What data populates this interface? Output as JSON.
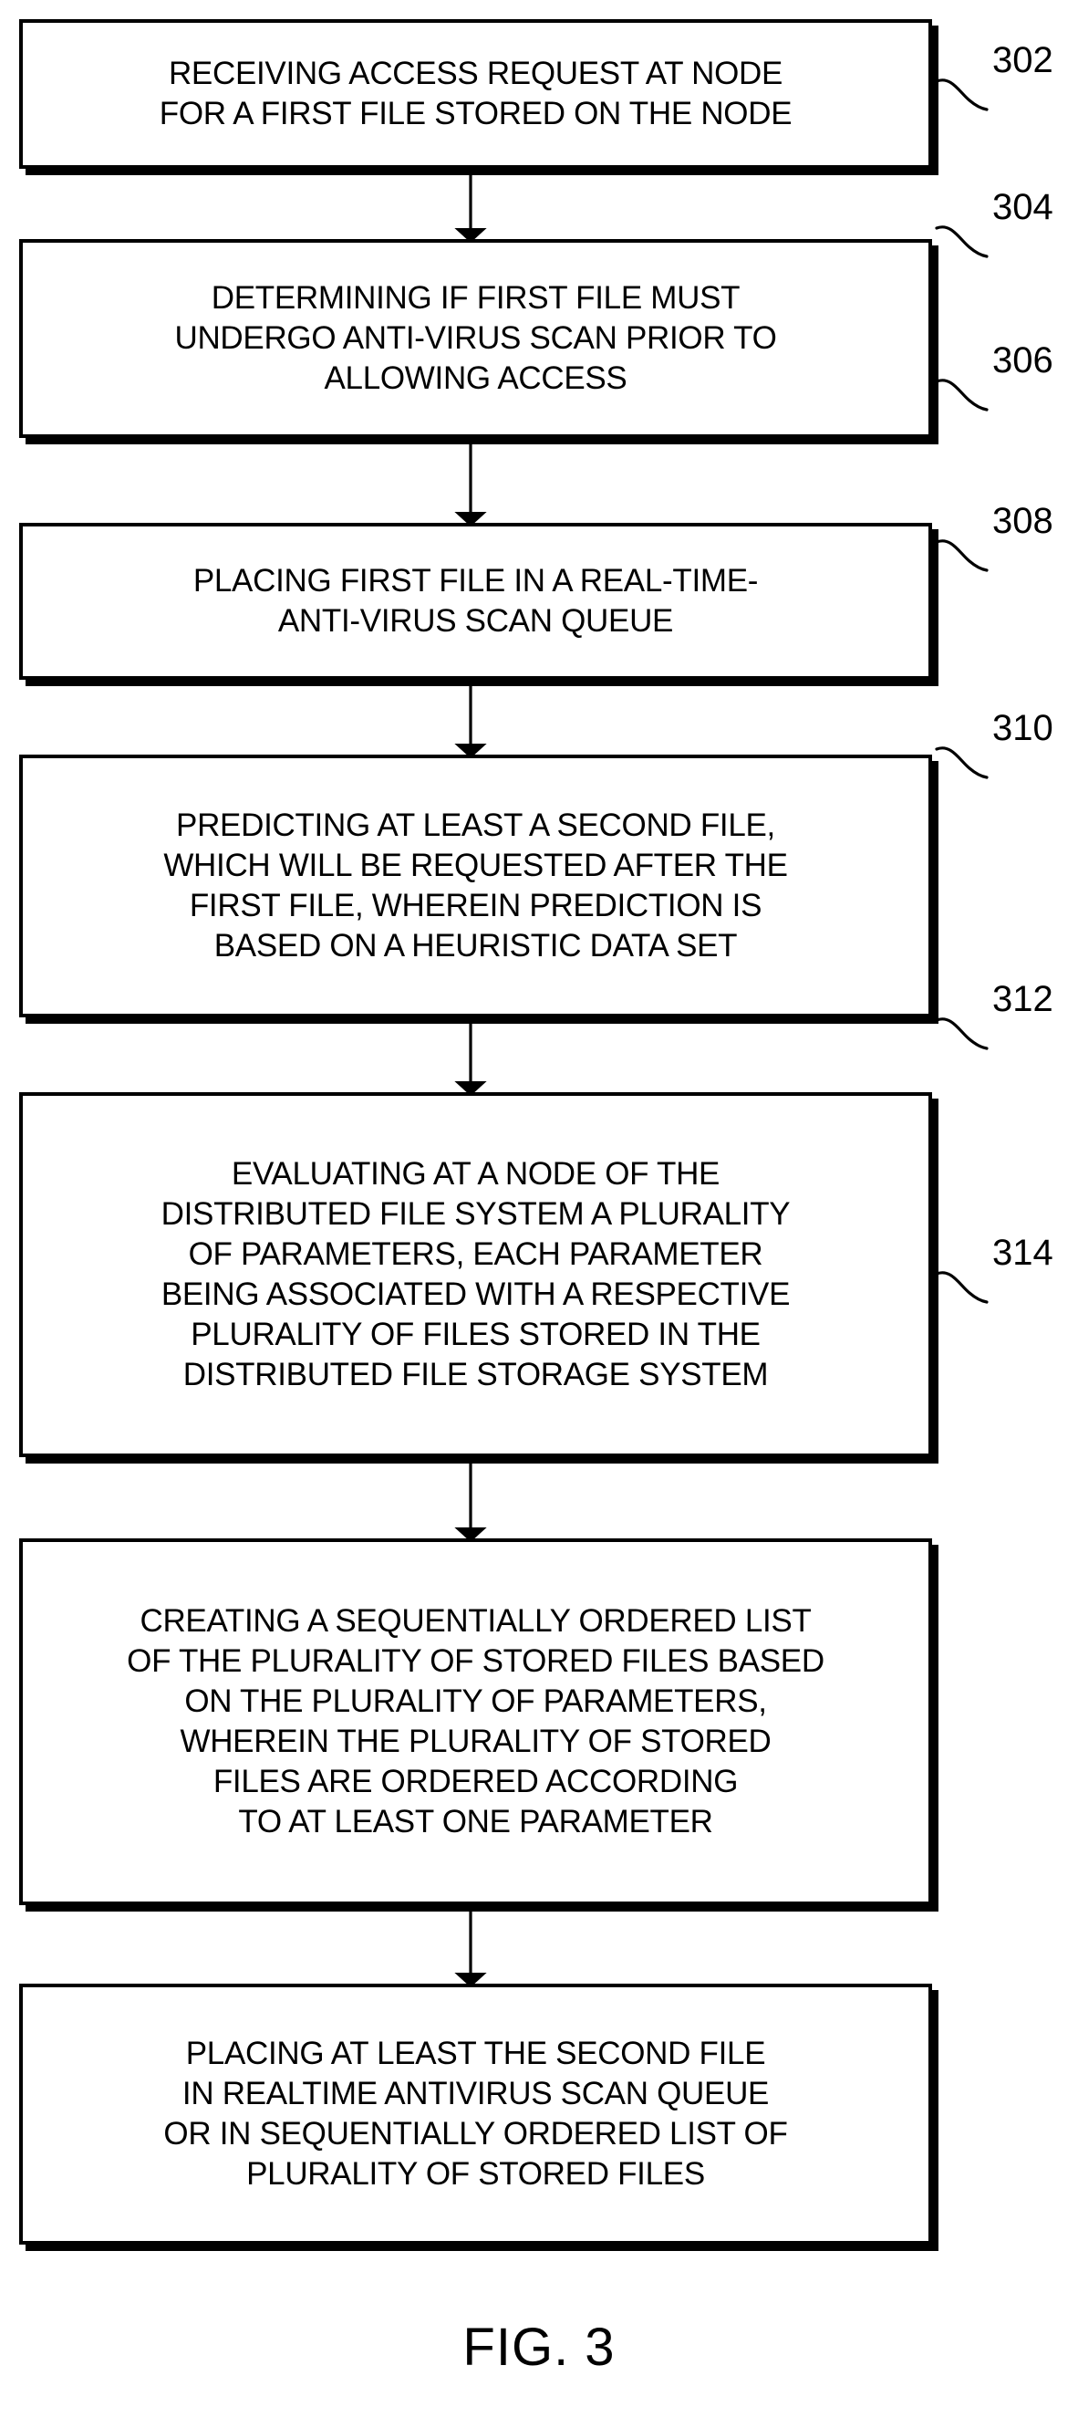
{
  "figure": {
    "caption": "FIG. 3",
    "type": "patent-flowchart",
    "steps": [
      {
        "ref": "302",
        "text": "RECEIVING ACCESS REQUEST AT NODE\nFOR A FIRST FILE STORED ON THE NODE"
      },
      {
        "ref": "304",
        "text": "DETERMINING IF FIRST FILE MUST\nUNDERGO ANTI-VIRUS SCAN PRIOR TO\nALLOWING ACCESS"
      },
      {
        "ref": "306",
        "text": "PLACING FIRST FILE IN A REAL-TIME-\nANTI-VIRUS SCAN QUEUE"
      },
      {
        "ref": "308",
        "text": "PREDICTING AT LEAST A SECOND FILE,\nWHICH WILL BE REQUESTED AFTER THE\nFIRST FILE, WHEREIN PREDICTION IS\nBASED ON A HEURISTIC DATA SET"
      },
      {
        "ref": "310",
        "text": "EVALUATING AT A NODE OF THE\nDISTRIBUTED FILE SYSTEM A PLURALITY\nOF PARAMETERS, EACH PARAMETER\nBEING ASSOCIATED WITH A RESPECTIVE\nPLURALITY OF FILES STORED IN THE\nDISTRIBUTED FILE STORAGE SYSTEM"
      },
      {
        "ref": "312",
        "text": "CREATING A SEQUENTIALLY ORDERED LIST\nOF THE PLURALITY OF STORED FILES BASED\nON THE PLURALITY OF PARAMETERS,\nWHEREIN THE PLURALITY OF STORED\nFILES ARE ORDERED ACCORDING\nTO AT LEAST ONE PARAMETER"
      },
      {
        "ref": "314",
        "text": "PLACING AT LEAST THE SECOND FILE\nIN REALTIME ANTIVIRUS SCAN QUEUE\nOR IN SEQUENTIALLY ORDERED LIST OF\nPLURALITY OF STORED FILES"
      }
    ],
    "connectors": [
      {
        "from": "302",
        "to": "304"
      },
      {
        "from": "304",
        "to": "306"
      },
      {
        "from": "306",
        "to": "308"
      },
      {
        "from": "308",
        "to": "310"
      },
      {
        "from": "310",
        "to": "312"
      },
      {
        "from": "312",
        "to": "314"
      }
    ],
    "colors": {
      "ink": "#000000",
      "paper": "#ffffff"
    }
  }
}
